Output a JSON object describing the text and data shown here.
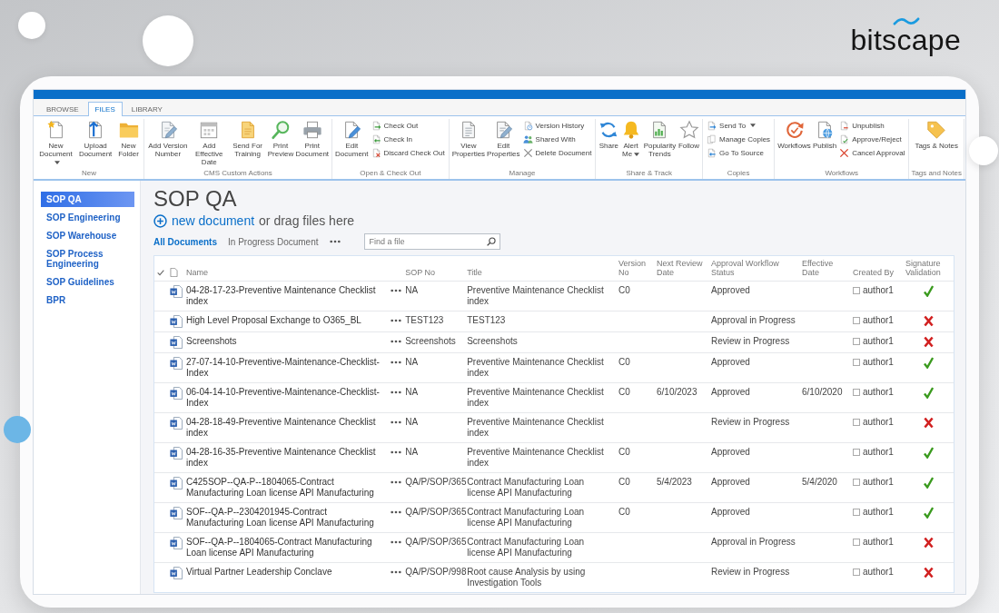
{
  "logo": {
    "text": "bitscape"
  },
  "ribbon": {
    "tabs": [
      {
        "label": "BROWSE",
        "selected": false
      },
      {
        "label": "FILES",
        "selected": true
      },
      {
        "label": "LIBRARY",
        "selected": false
      }
    ],
    "groups": [
      {
        "name": "New",
        "items": [
          {
            "kind": "large",
            "label": "New Document",
            "dropdown": true
          },
          {
            "kind": "large",
            "label": "Upload Document",
            "dropdown": false
          },
          {
            "kind": "large",
            "label": "New Folder",
            "dropdown": false
          }
        ]
      },
      {
        "name": "CMS Custom Actions",
        "items": [
          {
            "kind": "large",
            "label": "Add Version Number",
            "dropdown": false
          },
          {
            "kind": "large",
            "label": "Add Effective Date",
            "dropdown": false
          },
          {
            "kind": "large",
            "label": "Send For Training",
            "dropdown": false
          },
          {
            "kind": "large",
            "label": "Print Preview",
            "dropdown": false
          },
          {
            "kind": "large",
            "label": "Print Document",
            "dropdown": false
          }
        ]
      },
      {
        "name": "Open & Check Out",
        "items": [
          {
            "kind": "large",
            "label": "Edit Document",
            "dropdown": false
          },
          {
            "kind": "small",
            "label": "Check Out",
            "dropdown": false
          },
          {
            "kind": "small",
            "label": "Check In",
            "dropdown": false
          },
          {
            "kind": "small",
            "label": "Discard Check Out",
            "dropdown": false
          }
        ]
      },
      {
        "name": "Manage",
        "items": [
          {
            "kind": "large",
            "label": "View Properties",
            "dropdown": false
          },
          {
            "kind": "large",
            "label": "Edit Properties",
            "dropdown": false
          },
          {
            "kind": "small",
            "label": "Version History",
            "dropdown": false
          },
          {
            "kind": "small",
            "label": "Shared With",
            "dropdown": false
          },
          {
            "kind": "small",
            "label": "Delete Document",
            "dropdown": false
          }
        ]
      },
      {
        "name": "Share & Track",
        "items": [
          {
            "kind": "large",
            "label": "Share",
            "dropdown": false
          },
          {
            "kind": "large",
            "label": "Alert Me",
            "dropdown": true
          },
          {
            "kind": "large",
            "label": "Popularity Trends",
            "dropdown": false
          },
          {
            "kind": "large",
            "label": "Follow",
            "dropdown": false
          }
        ]
      },
      {
        "name": "Copies",
        "items": [
          {
            "kind": "small",
            "label": "Send To",
            "dropdown": true
          },
          {
            "kind": "small",
            "label": "Manage Copies",
            "dropdown": false
          },
          {
            "kind": "small",
            "label": "Go To Source",
            "dropdown": false
          }
        ]
      },
      {
        "name": "Workflows",
        "items": [
          {
            "kind": "large",
            "label": "Workflows",
            "dropdown": false
          },
          {
            "kind": "large",
            "label": "Publish",
            "dropdown": false
          },
          {
            "kind": "small",
            "label": "Unpublish",
            "dropdown": false
          },
          {
            "kind": "small",
            "label": "Approve/Reject",
            "dropdown": false
          },
          {
            "kind": "small",
            "label": "Cancel Approval",
            "dropdown": false
          }
        ]
      },
      {
        "name": "Tags and Notes",
        "items": [
          {
            "kind": "large",
            "label": "Tags & Notes",
            "dropdown": false
          }
        ]
      }
    ]
  },
  "nav": {
    "items": [
      {
        "label": "SOP QA",
        "selected": true
      },
      {
        "label": "SOP Engineering",
        "selected": false
      },
      {
        "label": "SOP Warehouse",
        "selected": false
      },
      {
        "label": "SOP Process Engineering",
        "selected": false
      },
      {
        "label": "SOP Guidelines",
        "selected": false
      },
      {
        "label": "BPR",
        "selected": false
      }
    ]
  },
  "library": {
    "title": "SOP QA",
    "new_document": "new document",
    "drag_hint": "or drag files here",
    "views": [
      {
        "label": "All Documents",
        "selected": true
      },
      {
        "label": "In Progress Document",
        "selected": false
      }
    ],
    "search": {
      "placeholder": "Find a file"
    },
    "columns": [
      "Name",
      "SOP No",
      "Title",
      "Version No",
      "Next Review Date",
      "Approval Workflow Status",
      "Effective Date",
      "Created By",
      "Signature Validation"
    ],
    "rows": [
      {
        "name": "04-28-17-23-Preventive Maintenance Checklist index",
        "sop_no": "NA",
        "title": "Preventive Maintenance Checklist index",
        "version": "C0",
        "status": "Approved",
        "created_by": "author1",
        "signature_valid": true
      },
      {
        "name": "High Level Proposal Exchange to O365_BL",
        "sop_no": "TEST123",
        "title": "TEST123",
        "status": "Approval in Progress",
        "created_by": "author1",
        "signature_valid": false
      },
      {
        "name": "Screenshots",
        "sop_no": "Screenshots",
        "title": "Screenshots",
        "status": "Review in Progress",
        "created_by": "author1",
        "signature_valid": false
      },
      {
        "name": "27-07-14-10-Preventive-Maintenance-Checklist-Index",
        "sop_no": "NA",
        "title": "Preventive Maintenance Checklist index",
        "version": "C0",
        "status": "Approved",
        "created_by": "author1",
        "signature_valid": true
      },
      {
        "name": "06-04-14-10-Preventive-Maintenance-Checklist-Index",
        "sop_no": "NA",
        "title": "Preventive Maintenance Checklist index",
        "version": "C0",
        "next_review": "6/10/2023",
        "status": "Approved",
        "effective_date": "6/10/2020",
        "created_by": "author1",
        "signature_valid": true
      },
      {
        "name": "04-28-18-49-Preventive Maintenance Checklist index",
        "sop_no": "NA",
        "title": "Preventive Maintenance Checklist index",
        "status": "Review in Progress",
        "created_by": "author1",
        "signature_valid": false
      },
      {
        "name": "04-28-16-35-Preventive Maintenance Checklist index",
        "sop_no": "NA",
        "title": "Preventive Maintenance Checklist index",
        "version": "C0",
        "status": "Approved",
        "created_by": "author1",
        "signature_valid": true
      },
      {
        "name": "C425SOP--QA-P--1804065-Contract Manufacturing Loan license API Manufacturing",
        "sop_no": "QA/P/SOP/365",
        "title": "Contract Manufacturing Loan license API Manufacturing",
        "version": "C0",
        "next_review": "5/4/2023",
        "status": "Approved",
        "effective_date": "5/4/2020",
        "created_by": "author1",
        "signature_valid": true
      },
      {
        "name": "SOF--QA-P--2304201945-Contract Manufacturing Loan license API Manufacturing",
        "sop_no": "QA/P/SOP/365",
        "title": "Contract Manufacturing Loan license API Manufacturing",
        "version": "C0",
        "status": "Approved",
        "created_by": "author1",
        "signature_valid": true
      },
      {
        "name": "SOF--QA-P--1804065-Contract Manufacturing Loan license API Manufacturing",
        "sop_no": "QA/P/SOP/365",
        "title": "Contract Manufacturing Loan license API Manufacturing",
        "status": "Approval in Progress",
        "created_by": "author1",
        "signature_valid": false
      },
      {
        "name": "Virtual Partner Leadership Conclave",
        "sop_no": "QA/P/SOP/998",
        "title": "Root cause Analysis by using Investigation Tools",
        "status": "Review in Progress",
        "created_by": "author1",
        "signature_valid": false
      }
    ]
  }
}
